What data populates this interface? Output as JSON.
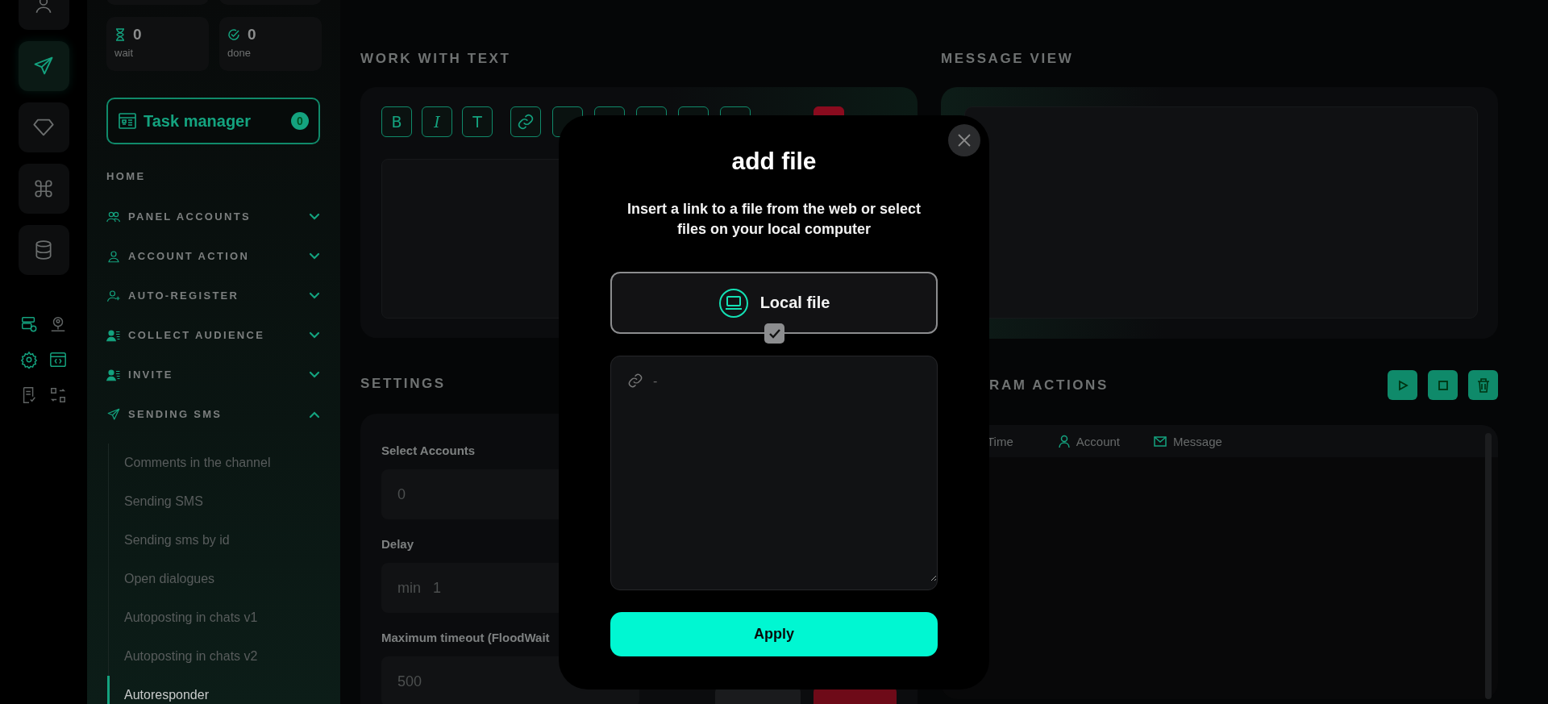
{
  "rail": {
    "items": [
      {
        "selected": false
      },
      {
        "selected": true
      },
      {
        "selected": false
      },
      {
        "selected": false
      },
      {
        "selected": false
      }
    ],
    "tools": [
      {
        "active": true
      },
      {
        "active": false
      },
      {
        "active": true
      },
      {
        "active": true
      },
      {
        "active": false
      },
      {
        "active": false
      }
    ]
  },
  "sidebar": {
    "stats": [
      {
        "value": "0",
        "label": "wait"
      },
      {
        "value": "0",
        "label": "done"
      }
    ],
    "task_manager": {
      "label": "Task manager",
      "count": "0"
    },
    "home": "HOME",
    "sections": [
      {
        "label": "PANEL ACCOUNTS",
        "expanded": false
      },
      {
        "label": "ACCOUNT ACTION",
        "expanded": false
      },
      {
        "label": "AUTO-REGISTER",
        "expanded": false
      },
      {
        "label": "COLLECT AUDIENCE",
        "expanded": false
      },
      {
        "label": "INVITE",
        "expanded": false
      },
      {
        "label": "SENDING SMS",
        "expanded": true,
        "children": [
          {
            "label": "Comments in the channel",
            "selected": false
          },
          {
            "label": "Sending SMS",
            "selected": false
          },
          {
            "label": "Sending sms by id",
            "selected": false
          },
          {
            "label": "Open dialogues",
            "selected": false
          },
          {
            "label": "Autoposting in chats v1",
            "selected": false
          },
          {
            "label": "Autoposting in chats v2",
            "selected": false
          },
          {
            "label": "Autoresponder",
            "selected": true
          }
        ]
      }
    ]
  },
  "work_with_text": {
    "title": "WORK WITH TEXT",
    "toolbar": [
      {
        "kind": "text",
        "label": "B"
      },
      {
        "kind": "italic",
        "label": "I"
      },
      {
        "kind": "text",
        "label": "T"
      },
      {
        "kind": "link"
      },
      {
        "kind": "covered"
      },
      {
        "kind": "covered"
      },
      {
        "kind": "covered"
      },
      {
        "kind": "covered"
      },
      {
        "kind": "covered"
      },
      {
        "kind": "danger"
      }
    ]
  },
  "message_view": {
    "title": "MESSAGE VIEW"
  },
  "settings": {
    "title": "SETTINGS",
    "fields": [
      {
        "label": "Select Accounts",
        "placeholder": "0"
      },
      {
        "label": "Delay",
        "prefix": "min",
        "placeholder": "1"
      },
      {
        "label": "Maximum timeout (FloodWait",
        "placeholder": "500"
      }
    ]
  },
  "program_actions": {
    "title": "RAM ACTIONS",
    "columns": [
      {
        "kind": "time",
        "label": "Time"
      },
      {
        "kind": "account",
        "label": "Account"
      },
      {
        "kind": "message",
        "label": "Message"
      }
    ]
  },
  "modal": {
    "title": "add file",
    "description": "Insert a link to a file from the web or select files on your local computer",
    "local_file": {
      "label": "Local file",
      "checked": true
    },
    "link_field": {
      "placeholder": "-"
    },
    "apply": "Apply"
  }
}
